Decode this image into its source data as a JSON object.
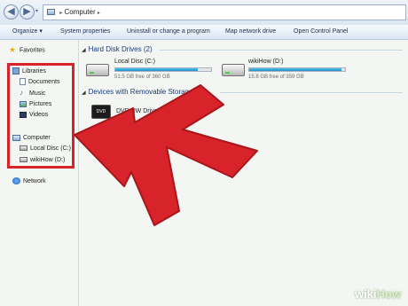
{
  "address_bar": {
    "path": [
      "Computer"
    ],
    "separator": "▸"
  },
  "toolbar": {
    "items": [
      "Organize ▾",
      "System properties",
      "Uninstall or change a program",
      "Map network drive",
      "Open Control Panel"
    ]
  },
  "nav": {
    "favorites": "Favorites",
    "libraries": "Libraries",
    "library_items": [
      "Documents",
      "Music",
      "Pictures",
      "Videos"
    ],
    "computer": "Computer",
    "computer_items": [
      "Local Disc (C:)",
      "wikiHow (D:)"
    ],
    "network": "Network"
  },
  "content": {
    "hdd_section": "Hard Disk Drives (2)",
    "drives": [
      {
        "name": "Local Disc (C:)",
        "free": "51.5 GB free of 360 GB",
        "used_fraction": 0.86
      },
      {
        "name": "wikiHow (D:)",
        "free": "15.8 GB free of 359 GB",
        "used_fraction": 0.96
      }
    ],
    "removable_section": "Devices with Removable Storage (1)",
    "removable": [
      {
        "name": "DVD RW Drive (F:)",
        "icon_label": "DVD"
      }
    ]
  },
  "annotations": {
    "highlight_color": "#d8232a",
    "arrow_color": "#d8232a"
  },
  "watermark": {
    "wiki": "wiki",
    "how": "How"
  }
}
